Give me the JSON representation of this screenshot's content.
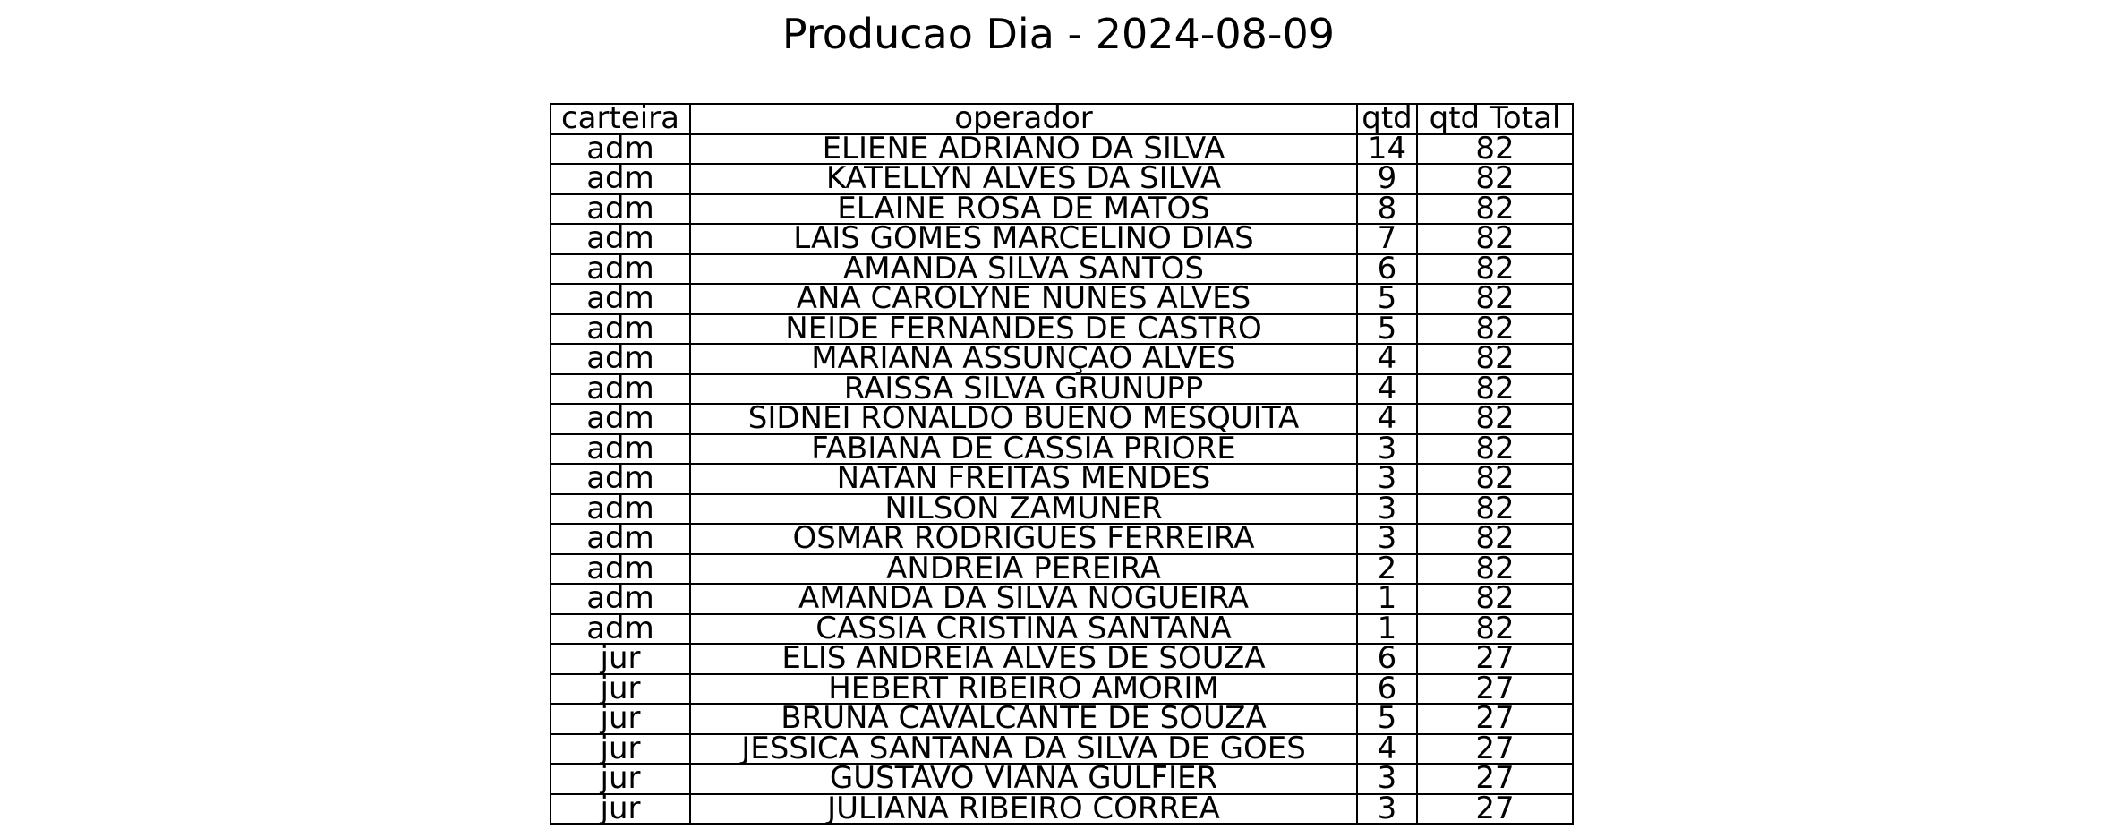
{
  "chart_data": {
    "type": "table",
    "title": "Producao Dia - 2024-08-09",
    "columns": [
      "carteira",
      "operador",
      "qtd",
      "qtd Total"
    ],
    "rows": [
      [
        "adm",
        "ELIENE ADRIANO DA SILVA",
        "14",
        "82"
      ],
      [
        "adm",
        "KATELLYN ALVES DA SILVA",
        "9",
        "82"
      ],
      [
        "adm",
        "ELAINE ROSA DE MATOS",
        "8",
        "82"
      ],
      [
        "adm",
        "LAIS GOMES MARCELINO DIAS",
        "7",
        "82"
      ],
      [
        "adm",
        "AMANDA SILVA SANTOS",
        "6",
        "82"
      ],
      [
        "adm",
        "ANA CAROLYNE NUNES ALVES",
        "5",
        "82"
      ],
      [
        "adm",
        "NEIDE FERNANDES DE CASTRO",
        "5",
        "82"
      ],
      [
        "adm",
        "MARIANA ASSUNÇÃO ALVES",
        "4",
        "82"
      ],
      [
        "adm",
        "RAISSA SILVA GRUNUPP",
        "4",
        "82"
      ],
      [
        "adm",
        "SIDNEI RONALDO BUENO MESQUITA",
        "4",
        "82"
      ],
      [
        "adm",
        "FABIANA DE CÁSSIA PRIORE",
        "3",
        "82"
      ],
      [
        "adm",
        "NATAN FREITAS MENDES",
        "3",
        "82"
      ],
      [
        "adm",
        "NILSON ZAMUNER",
        "3",
        "82"
      ],
      [
        "adm",
        "OSMAR RODRIGUES FERREIRA",
        "3",
        "82"
      ],
      [
        "adm",
        "ANDREIA PEREIRA",
        "2",
        "82"
      ],
      [
        "adm",
        "AMANDA DA SILVA NOGUEIRA",
        "1",
        "82"
      ],
      [
        "adm",
        "CASSIA CRISTINA SANTANA",
        "1",
        "82"
      ],
      [
        "jur",
        "ELIS ANDRÉIA ALVES DE SOUZA",
        "6",
        "27"
      ],
      [
        "jur",
        "HEBERT RIBEIRO AMORIM",
        "6",
        "27"
      ],
      [
        "jur",
        "BRUNA CAVALCANTE DE SOUZA",
        "5",
        "27"
      ],
      [
        "jur",
        "JESSICA SANTANA DA SILVA DE GOES",
        "4",
        "27"
      ],
      [
        "jur",
        "GUSTAVO VIANA GULFIER",
        "3",
        "27"
      ],
      [
        "jur",
        "JULIANA RIBEIRO CORRÊA",
        "3",
        "27"
      ]
    ]
  }
}
